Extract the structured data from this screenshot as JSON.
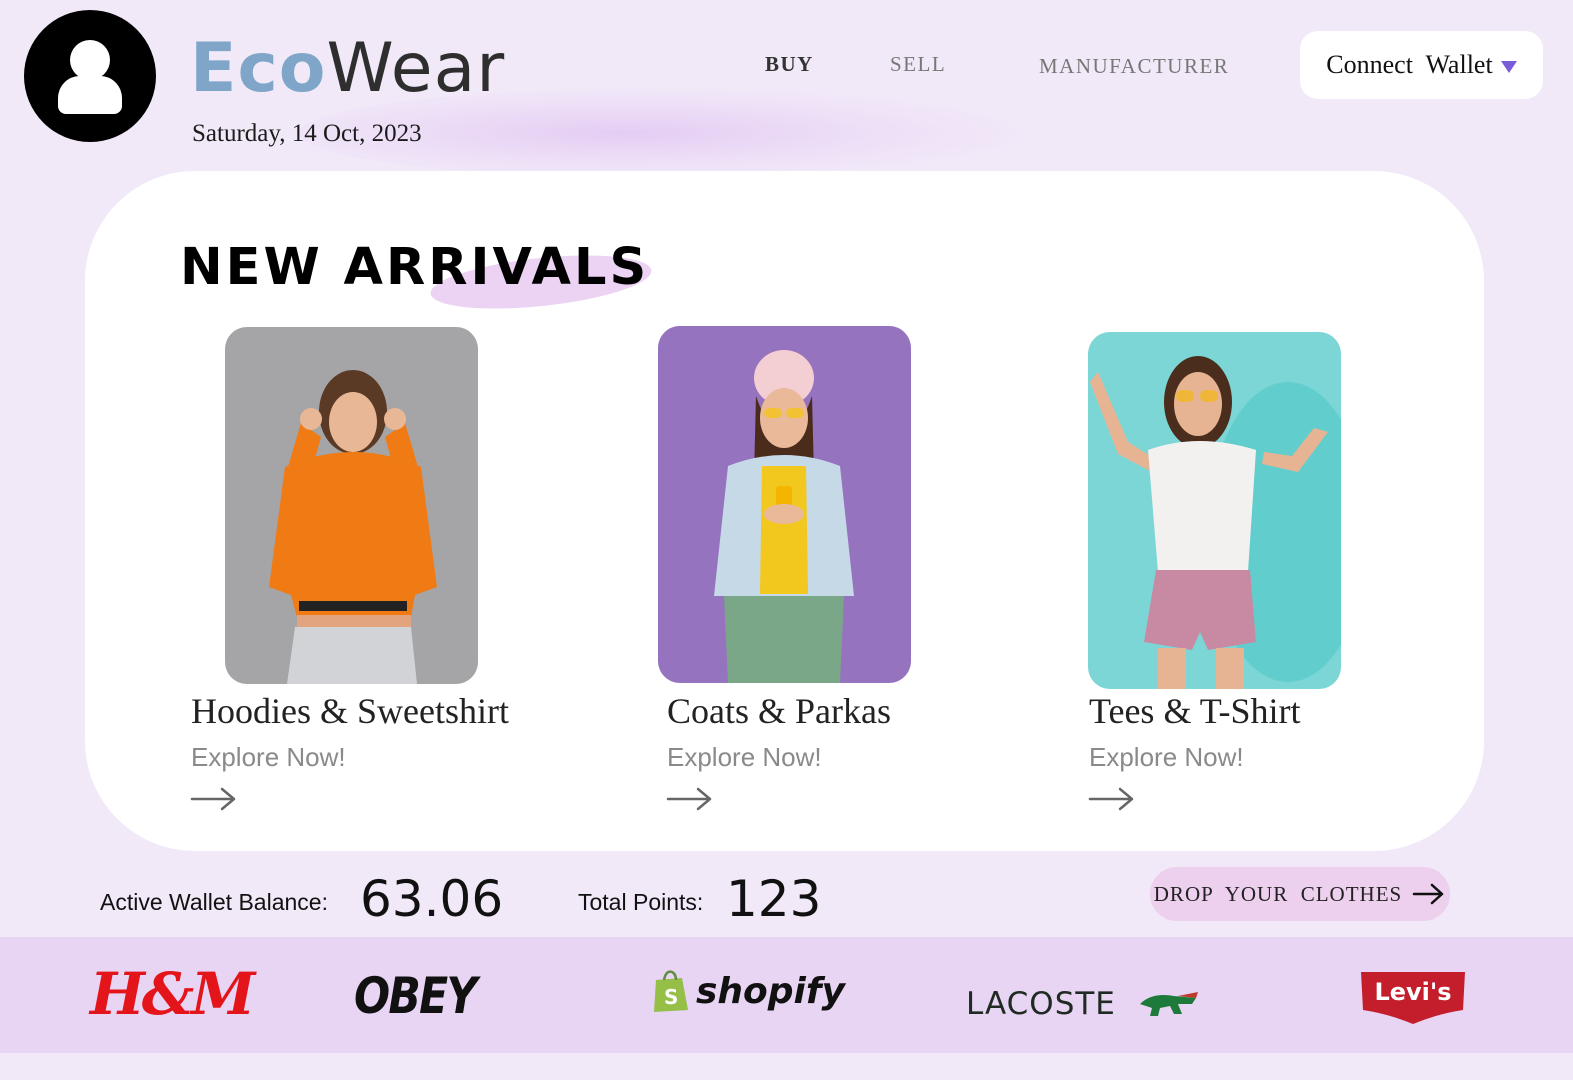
{
  "header": {
    "brand_part1": "Eco",
    "brand_part2": "Wear",
    "date": "Saturday, 14 Oct, 2023",
    "nav": {
      "buy": "BUY",
      "sell": "SELL",
      "manufacturer": "MANUFACTURER"
    },
    "connect_wallet": "Connect  Wallet"
  },
  "main": {
    "heading": "NEW ARRIVALS",
    "categories": [
      {
        "title": "Hoodies  &  Sweetshirt",
        "cta": "Explore Now!",
        "photo_bg": "#a5a5a7"
      },
      {
        "title": "Coats  &  Parkas",
        "cta": "Explore Now!",
        "photo_bg": "#9b7bc4"
      },
      {
        "title": "Tees  &  T-Shirt",
        "cta": "Explore Now!",
        "photo_bg": "#7dd6d6"
      }
    ]
  },
  "stats": {
    "balance_label": "Active Wallet Balance:",
    "balance_value": "63.06",
    "points_label": "Total Points:",
    "points_value": "123"
  },
  "drop_button": "DROP  YOUR  CLOTHES",
  "brands": {
    "hm": "H&M",
    "obey": "OBEY",
    "shopify": "shopify",
    "lacoste": "LACOSTE",
    "levis": "Levi's"
  },
  "colors": {
    "page_bg": "#f1e8f8",
    "brand_eco": "#7fa6c8",
    "accent_caret": "#7a5bd8",
    "drop_button_bg": "#edcfee",
    "brands_strip_bg": "#e8d4f3"
  }
}
